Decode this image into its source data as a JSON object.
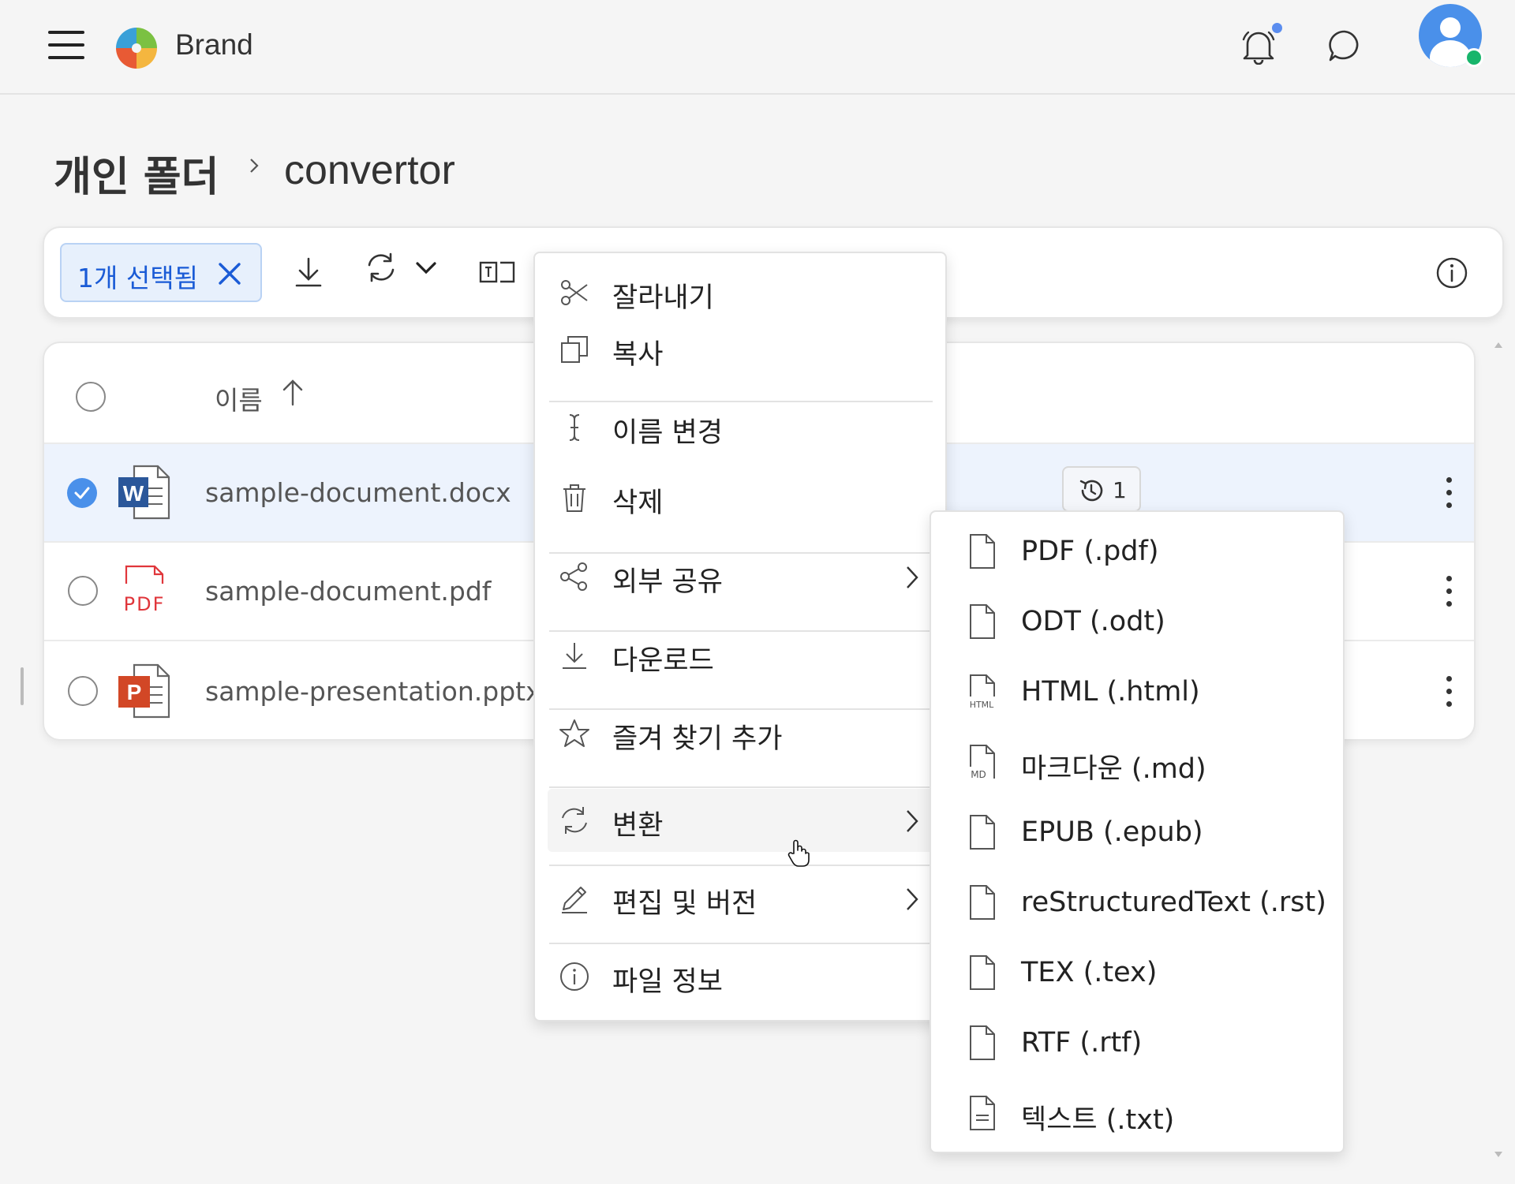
{
  "header": {
    "brand": "Brand",
    "icons": [
      "menu-icon",
      "brand-logo",
      "bell-icon",
      "chat-icon",
      "user-avatar"
    ]
  },
  "breadcrumb": {
    "root": "개인 폴더",
    "current": "convertor"
  },
  "toolbar": {
    "selection_label": "1개 선택됨",
    "icons": [
      "close-icon",
      "download-icon",
      "convert-icon",
      "chevron-down-icon",
      "rename-icon",
      "info-icon"
    ]
  },
  "table": {
    "column_name": "이름",
    "rows": [
      {
        "name": "sample-document.docx",
        "type": "word",
        "selected": true,
        "version_count": "1"
      },
      {
        "name": "sample-document.pdf",
        "type": "pdf",
        "selected": false
      },
      {
        "name": "sample-presentation.pptx",
        "type": "powerpoint",
        "selected": false
      }
    ],
    "pdf_icon_text": "PDF",
    "word_icon_letter": "W",
    "ppt_icon_letter": "P"
  },
  "context_menu": {
    "items": [
      {
        "label": "잘라내기",
        "icon": "scissors-icon"
      },
      {
        "label": "복사",
        "icon": "copy-icon"
      },
      {
        "label": "이름 변경",
        "icon": "text-cursor-icon"
      },
      {
        "label": "삭제",
        "icon": "trash-icon"
      },
      {
        "label": "외부 공유",
        "icon": "share-icon",
        "submenu": true
      },
      {
        "label": "다운로드",
        "icon": "download-icon"
      },
      {
        "label": "즐겨 찾기 추가",
        "icon": "star-icon"
      },
      {
        "label": "변환",
        "icon": "convert-icon",
        "submenu": true,
        "active": true
      },
      {
        "label": "편집 및 버전",
        "icon": "pencil-icon",
        "submenu": true
      },
      {
        "label": "파일 정보",
        "icon": "info-icon"
      }
    ]
  },
  "convert_submenu": {
    "items": [
      {
        "label": "PDF (.pdf)",
        "icon": "file-icon"
      },
      {
        "label": "ODT (.odt)",
        "icon": "file-icon"
      },
      {
        "label": "HTML (.html)",
        "icon": "html-file-icon",
        "tag": "HTML"
      },
      {
        "label": "마크다운 (.md)",
        "icon": "md-file-icon",
        "tag": "MD"
      },
      {
        "label": "EPUB (.epub)",
        "icon": "file-icon"
      },
      {
        "label": "reStructuredText (.rst)",
        "icon": "file-icon"
      },
      {
        "label": "TEX (.tex)",
        "icon": "file-icon"
      },
      {
        "label": "RTF (.rtf)",
        "icon": "file-icon"
      },
      {
        "label": "텍스트 (.txt)",
        "icon": "text-file-icon"
      }
    ]
  },
  "colors": {
    "accent": "#1a5bd6",
    "avatar": "#4a90ea",
    "online": "#18b56b",
    "word": "#2b579a",
    "pdf": "#e0363b",
    "ppt": "#d24726"
  }
}
